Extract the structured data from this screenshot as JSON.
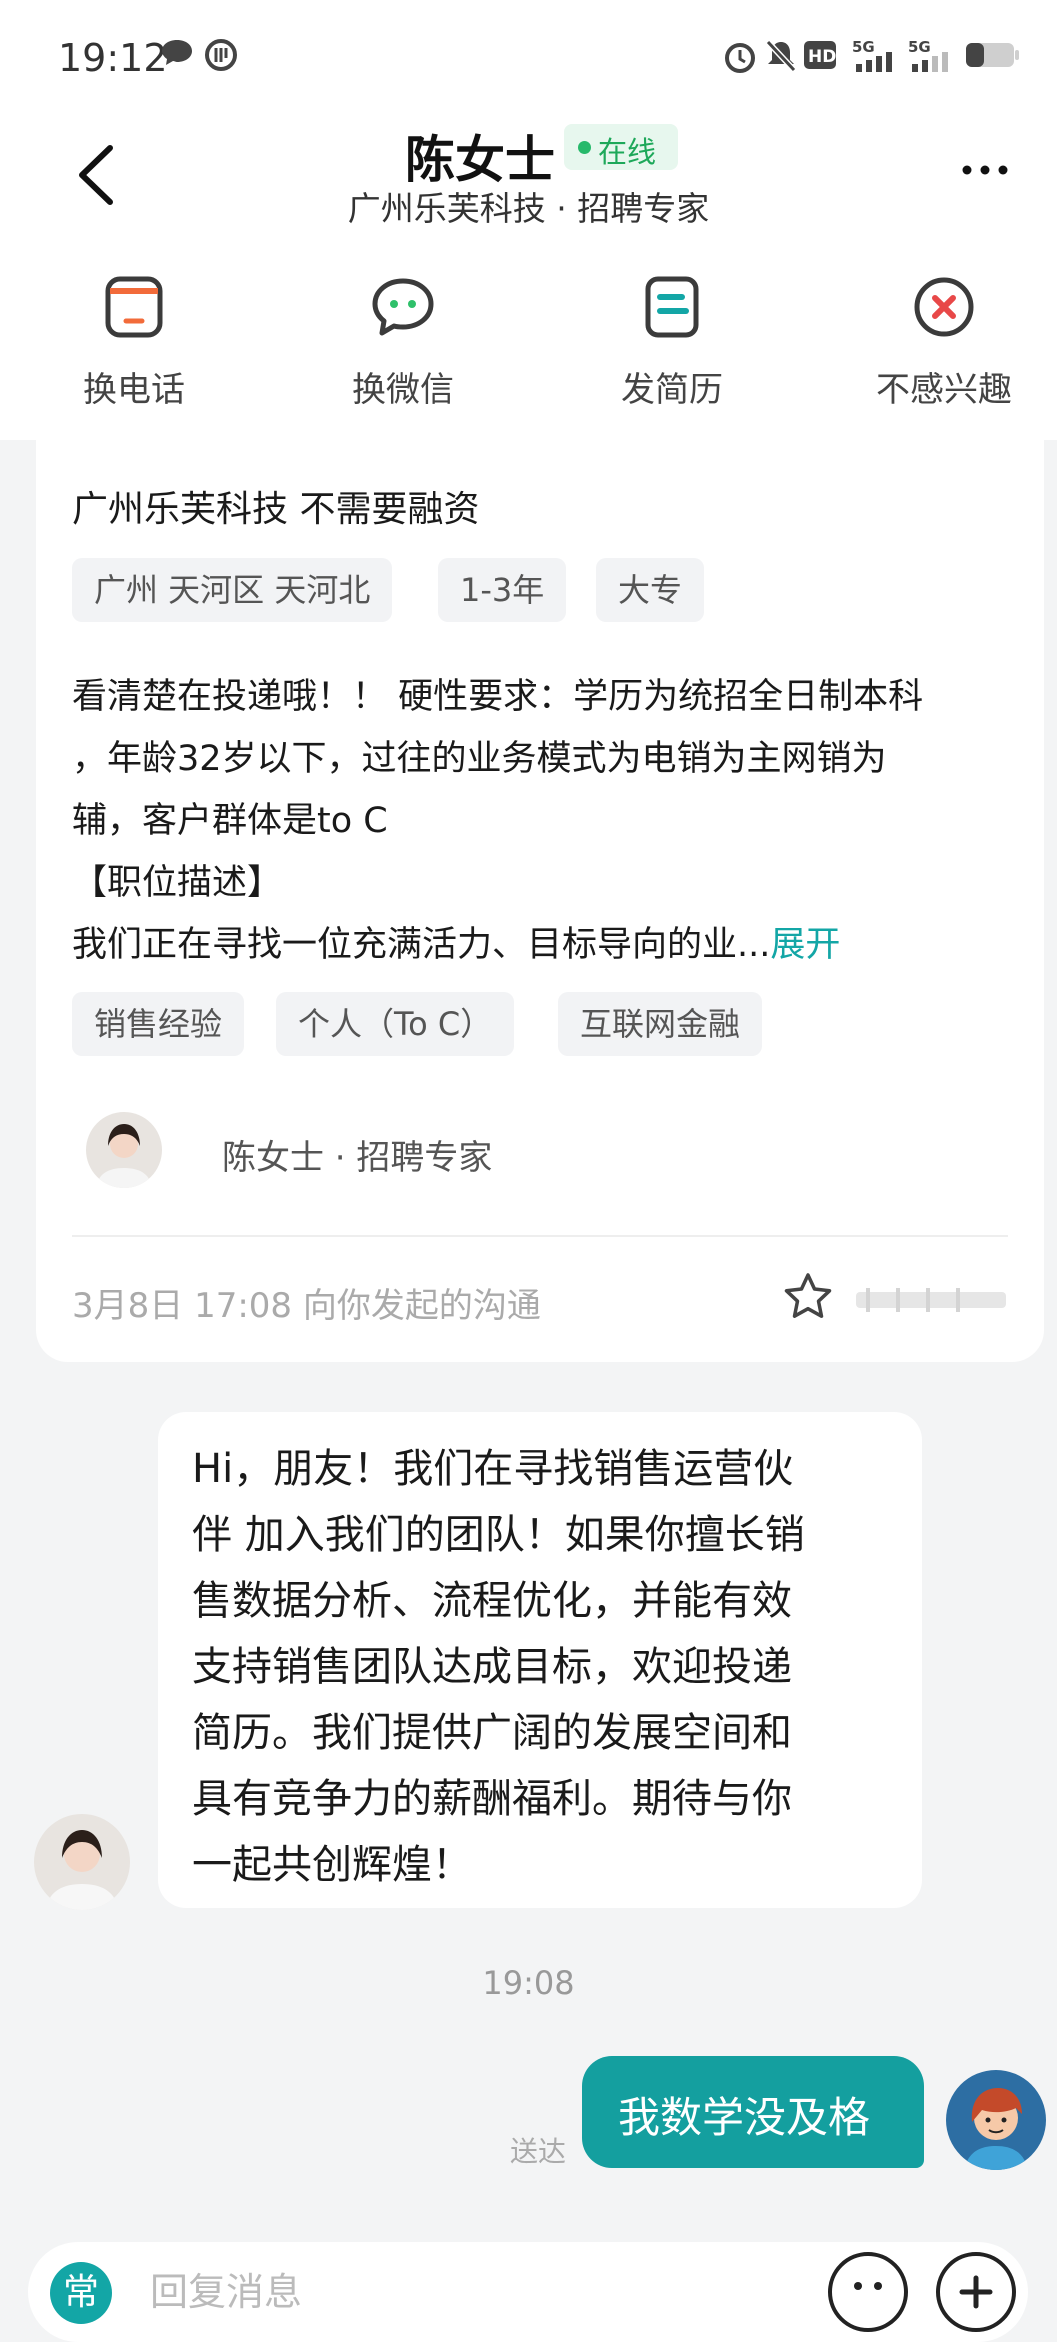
{
  "status_bar": {
    "time": "19:12",
    "icons": [
      "message-bubble-icon",
      "vpn-icon",
      "alarm-icon",
      "mute-icon",
      "hd-icon",
      "signal-5g-icon",
      "signal-5g-icon",
      "battery-icon"
    ]
  },
  "header": {
    "contact_name": "陈女士",
    "online_status": "在线",
    "subtitle": "广州乐芙科技 · 招聘专家"
  },
  "actions": [
    {
      "label": "换电话",
      "icon": "phone-icon"
    },
    {
      "label": "换微信",
      "icon": "wechat-icon"
    },
    {
      "label": "发简历",
      "icon": "resume-icon"
    },
    {
      "label": "不感兴趣",
      "icon": "close-circle-icon"
    }
  ],
  "job_card": {
    "company_line": "广州乐芙科技  不需要融资",
    "tags": [
      "广州 天河区 天河北",
      "1-3年",
      "大专"
    ],
    "description_lines": [
      "看清楚在投递哦！！ 硬性要求：学历为统招全日制本科",
      "，年龄32岁以下，过往的业务模式为电销为主网销为",
      "辅，客户群体是to C",
      "【职位描述】"
    ],
    "description_last": "我们正在寻找一位充满活力、目标导向的业...",
    "expand_label": "展开",
    "skill_tags": [
      "销售经验",
      "个人（To C）",
      "互联网金融"
    ],
    "recruiter_line": "陈女士  ·  招聘专家",
    "footer": "3月8日 17:08 向你发起的沟通"
  },
  "messages": {
    "incoming_lines": [
      "Hi，朋友！我们在寻找销售运营伙",
      "伴 加入我们的团队！如果你擅长销",
      "售数据分析、流程优化，并能有效",
      "支持销售团队达成目标，欢迎投递",
      "简历。我们提供广阔的发展空间和",
      "具有竞争力的薪酬福利。期待与你",
      "一起共创辉煌！"
    ],
    "time": "19:08",
    "outgoing": "我数学没及格",
    "sent_status": "送达"
  },
  "input_bar": {
    "quick_label": "常",
    "placeholder": "回复消息"
  },
  "colors": {
    "accent": "#149f9f",
    "online_green": "#27b96b",
    "bubble_white": "#ffffff",
    "background": "#f3f4f5"
  }
}
